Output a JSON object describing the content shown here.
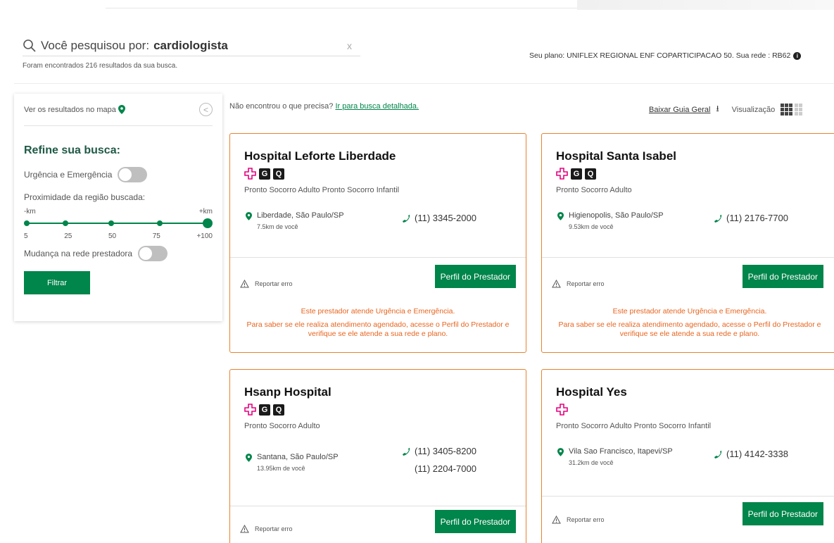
{
  "search": {
    "prefix": "Você pesquisou por:",
    "term": "cardiologista",
    "clear": "x",
    "results_text": "Foram encontrados 216 resultados da sua busca."
  },
  "plan": {
    "text": "Seu plano: UNIFLEX REGIONAL ENF COPARTICIPACAO 50. Sua rede : RB62",
    "info_icon": "i"
  },
  "sidebar": {
    "map_link": "Ver os resultados no mapa",
    "collapse_icon": "<",
    "refine_title": "Refine sua busca:",
    "urgency_label": "Urgência e Emergência",
    "proximity_label": "Proximidade da região buscada:",
    "km_min": "-km",
    "km_max": "+km",
    "ticks": [
      "5",
      "25",
      "50",
      "75",
      "+100"
    ],
    "slider_value": "+100",
    "network_change_label": "Mudança na rede prestadora",
    "filter_button": "Filtrar"
  },
  "top_actions": {
    "not_found": "Não encontrou o que precisa?",
    "detailed_search_link": "Ir para busca detalhada.",
    "download_link": "Baixar Guia Geral",
    "view_label": "Visualização"
  },
  "cards": [
    {
      "name": "Hospital Leforte Liberdade",
      "badges": [
        "G",
        "Q"
      ],
      "specialties": "Pronto Socorro Adulto   Pronto Socorro Infantil",
      "location": "Liberdade, São Paulo/SP",
      "distance": "7.5km de você",
      "phones": [
        "(11) 3345-2000"
      ],
      "report": "Reportar erro",
      "profile_button": "Perfil do Prestador",
      "notice_1": "Este prestador atende Urgência e Emergência.",
      "notice_2": "Para saber se ele realiza atendimento agendado, acesse o Perfil do Prestador e verifique se ele atende a sua rede e plano."
    },
    {
      "name": "Hospital Santa Isabel",
      "badges": [
        "G",
        "Q"
      ],
      "specialties": "Pronto Socorro Adulto",
      "location": "Higienopolis, São Paulo/SP",
      "distance": "9.53km de você",
      "phones": [
        "(11) 2176-7700"
      ],
      "report": "Reportar erro",
      "profile_button": "Perfil do Prestador",
      "notice_1": "Este prestador atende Urgência e Emergência.",
      "notice_2": "Para saber se ele realiza atendimento agendado, acesse o Perfil do Prestador e verifique se ele atende a sua rede e plano."
    },
    {
      "name": "Hsanp Hospital",
      "badges": [
        "G",
        "Q"
      ],
      "specialties": "Pronto Socorro Adulto",
      "location": "Santana, São Paulo/SP",
      "distance": "13.95km de você",
      "phones": [
        "(11) 3405-8200",
        "(11) 2204-7000"
      ],
      "report": "Reportar erro",
      "profile_button": "Perfil do Prestador"
    },
    {
      "name": "Hospital Yes",
      "badges": [],
      "specialties": "Pronto Socorro Adulto   Pronto Socorro Infantil",
      "location": "Vila Sao Francisco, Itapevi/SP",
      "distance": "31.2km de você",
      "phones": [
        "(11) 4142-3338"
      ],
      "report": "Reportar erro",
      "profile_button": "Perfil do Prestador"
    }
  ],
  "colors": {
    "brand_green": "#00854a",
    "card_border": "#e8822e",
    "notice_text": "#e8641e",
    "cross_icon": "#e6007e"
  }
}
